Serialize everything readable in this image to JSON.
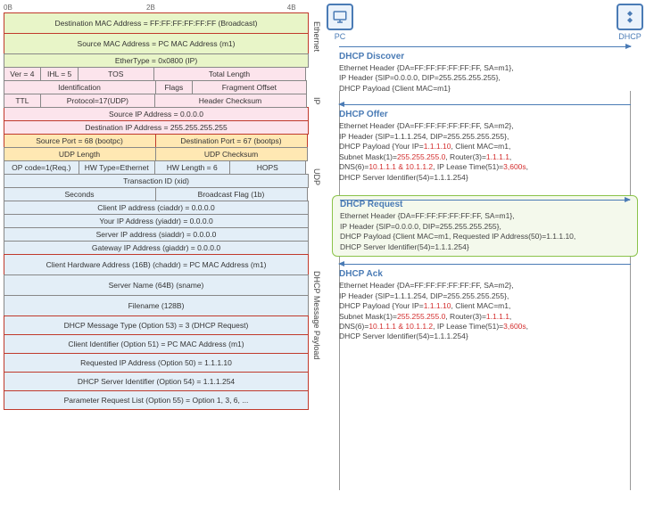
{
  "ruler": {
    "b0": "0B",
    "b2": "2B",
    "b4": "4B"
  },
  "layers": {
    "eth": "Ethernet",
    "ip": "IP",
    "udp": "UDP",
    "dhcp": "DHCP Message Payload"
  },
  "packet": {
    "eth_dst": "Destination MAC Address = FF:FF:FF:FF:FF:FF (Broadcast)",
    "eth_src": "Source MAC Address = PC MAC Address (m1)",
    "eth_type": "EtherType = 0x0800 (IP)",
    "ip_ver": "Ver = 4",
    "ip_ihl": "IHL = 5",
    "ip_tos": "TOS",
    "ip_len": "Total Length",
    "ip_id": "Identification",
    "ip_flags": "Flags",
    "ip_frag": "Fragment Offset",
    "ip_ttl": "TTL",
    "ip_proto": "Protocol=17(UDP)",
    "ip_chk": "Header Checksum",
    "ip_src": "Source IP Address = 0.0.0.0",
    "ip_dst": "Destination IP Address = 255.255.255.255",
    "udp_src": "Source Port = 68 (bootpc)",
    "udp_dst": "Destination Port = 67 (bootps)",
    "udp_len": "UDP Length",
    "udp_chk": "UDP Checksum",
    "d_op": "OP code=1(Req.)",
    "d_hwt": "HW Type=Ethernet",
    "d_hwl": "HW Length = 6",
    "d_hops": "HOPS",
    "d_xid": "Transaction ID (xid)",
    "d_sec": "Seconds",
    "d_bflag": "Broadcast Flag (1b)",
    "d_ciaddr": "Client IP address (ciaddr) = 0.0.0.0",
    "d_yiaddr": "Your IP Address (yiaddr) = 0.0.0.0",
    "d_siaddr": "Server IP address (siaddr) = 0.0.0.0",
    "d_giaddr": "Gateway IP Address (giaddr) = 0.0.0.0",
    "d_chaddr": "Client Hardware Address (16B) (chaddr) = PC MAC Address (m1)",
    "d_sname": "Server Name (64B) (sname)",
    "d_file": "Filename (128B)",
    "d_opt53": "DHCP Message Type (Option 53) = 3 (DHCP Request)",
    "d_opt51": "Client Identifier (Option 51) = PC MAC Address (m1)",
    "d_opt50": "Requested IP Address (Option 50) = 1.1.1.10",
    "d_opt54": "DHCP Server Identifier (Option 54) = 1.1.1.254",
    "d_opt55": "Parameter Request List (Option 55) = Option 1, 3, 6, ..."
  },
  "nodes": {
    "pc": "PC",
    "dhcp": "DHCP"
  },
  "seq": {
    "discover": {
      "title": "DHCP Discover",
      "l1": "Ethernet Header {DA=FF:FF:FF:FF:FF:FF, SA=m1},",
      "l2": "IP Header {SIP=0.0.0.0, DIP=255.255.255.255},",
      "l3": "DHCP Payload {Client MAC=m1}"
    },
    "offer": {
      "title": "DHCP Offer",
      "l1": "Ethernet Header {DA=FF:FF:FF:FF:FF:FF, SA=m2},",
      "l2": "IP Header {SIP=1.1.1.254, DIP=255.255.255.255},",
      "l3a": "DHCP Payload {Your IP=",
      "l3b": "1.1.1.10",
      "l3c": ", Client MAC=m1,",
      "l4a": "Subnet Mask(1)=",
      "l4b": "255.255.255.0",
      "l4c": ", Router(3)=",
      "l4d": "1.1.1.1",
      "l4e": ",",
      "l5a": "DNS(6)=",
      "l5b": "10.1.1.1 & 10.1.1.2",
      "l5c": ", IP Lease Time(51)=",
      "l5d": "3,600s",
      "l5e": ",",
      "l6": "DHCP Server Identifier(54)=1.1.1.254}"
    },
    "request": {
      "title": "DHCP Request",
      "l1": "Ethernet Header {DA=FF:FF:FF:FF:FF:FF, SA=m1},",
      "l2": "IP Header {SIP=0.0.0.0, DIP=255.255.255.255},",
      "l3": "DHCP Payload {Client MAC=m1, Requested IP Address(50)=1.1.1.10,",
      "l4": "DHCP Server Identifier(54)=1.1.1.254}"
    },
    "ack": {
      "title": "DHCP Ack",
      "l1": "Ethernet Header {DA=FF:FF:FF:FF:FF:FF, SA=m2},",
      "l2": "IP Header {SIP=1.1.1.254, DIP=255.255.255.255},",
      "l3a": "DHCP Payload {Your IP=",
      "l3b": "1.1.1.10",
      "l3c": ", Client MAC=m1,",
      "l4a": "Subnet Mask(1)=",
      "l4b": "255.255.255.0",
      "l4c": ", Router(3)=",
      "l4d": "1.1.1.1",
      "l4e": ",",
      "l5a": "DNS(6)=",
      "l5b": "10.1.1.1 & 10.1.1.2",
      "l5c": ", IP Lease Time(51)=",
      "l5d": "3,600s",
      "l5e": ",",
      "l6": "DHCP Server Identifier(54)=1.1.1.254}"
    }
  }
}
